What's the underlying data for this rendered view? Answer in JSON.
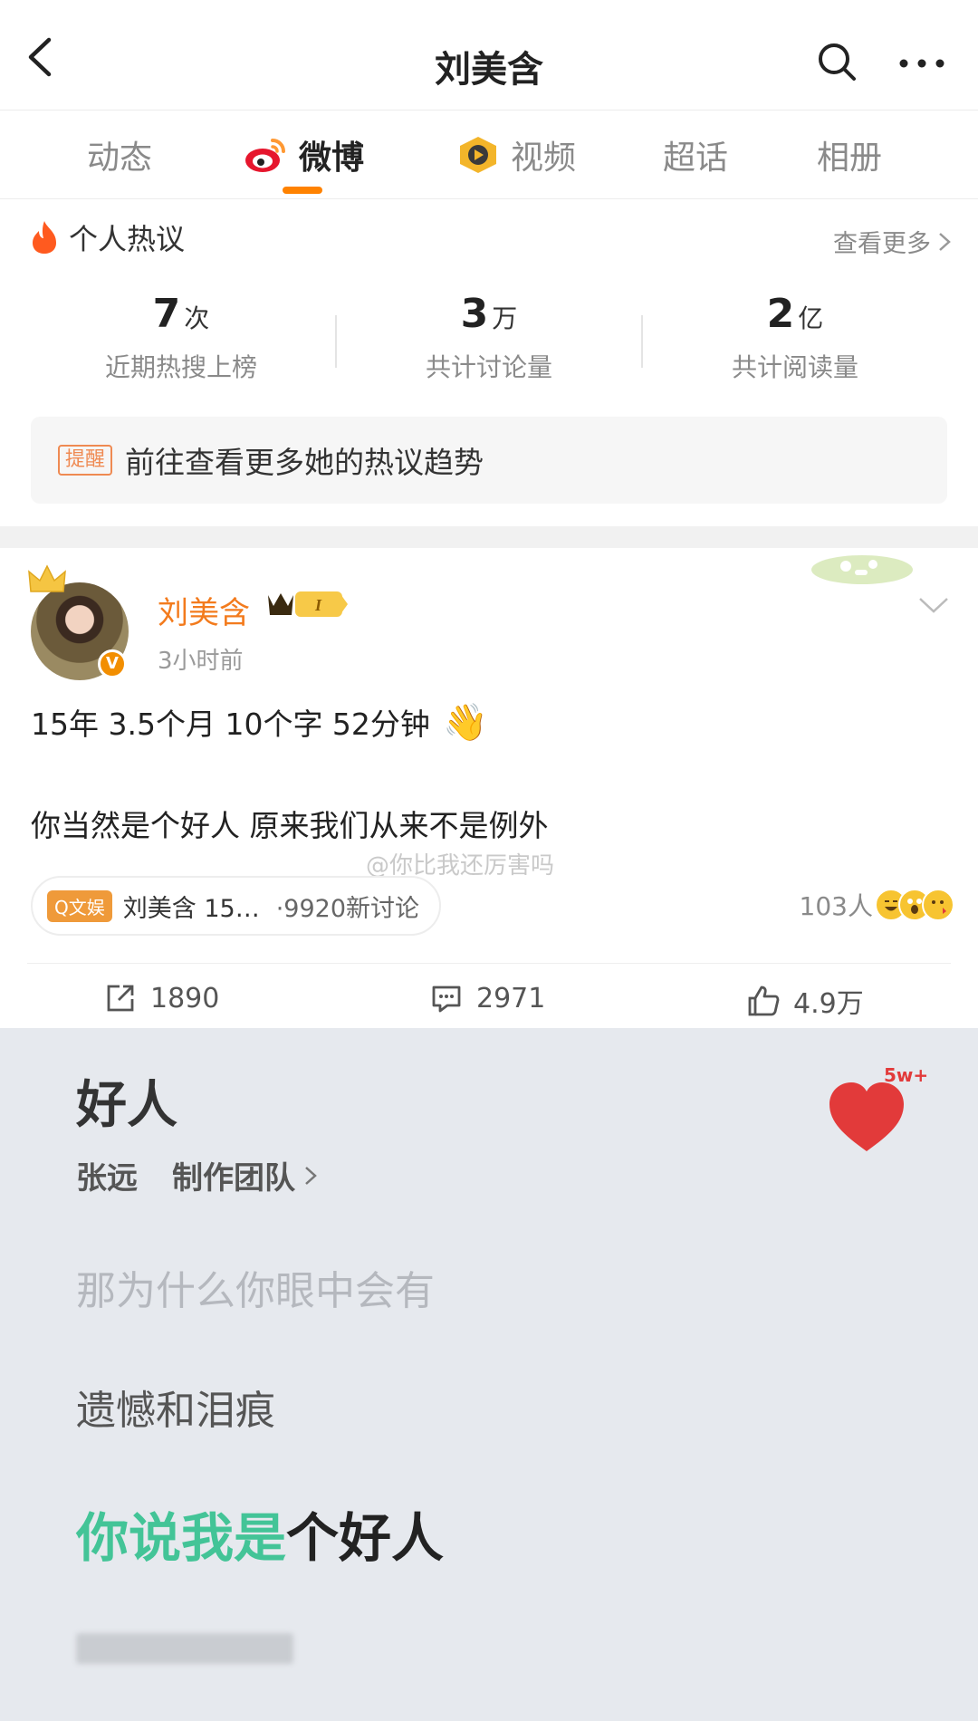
{
  "navbar": {
    "title": "刘美含"
  },
  "tabs": [
    {
      "label": "动态"
    },
    {
      "label": "微博"
    },
    {
      "label": "视频"
    },
    {
      "label": "超话"
    },
    {
      "label": "相册"
    }
  ],
  "hot": {
    "title": "个人热议",
    "see_more": "查看更多",
    "stats": [
      {
        "num": "7",
        "unit": "次",
        "label": "近期热搜上榜"
      },
      {
        "num": "3",
        "unit": "万",
        "label": "共计讨论量"
      },
      {
        "num": "2",
        "unit": "亿",
        "label": "共计阅读量"
      }
    ],
    "reminder_tag": "提醒",
    "reminder_text": "前往查看更多她的热议趋势"
  },
  "post": {
    "user_name": "刘美含",
    "time": "3小时前",
    "line1": "15年 3.5个月 10个字 52分钟",
    "line1_emoji": "👋",
    "line2": "你当然是个好人   原来我们从来不是例外",
    "watermark": "@你比我还厉害吗",
    "topic_tag": "Q文娱",
    "topic_title": "刘美含 15…",
    "topic_discuss": "·9920新讨论",
    "reactors_count": "103人",
    "reposts": "1890",
    "comments": "2971",
    "likes": "4.9万"
  },
  "song": {
    "title": "好人",
    "artist": "张远",
    "team": "制作团队",
    "heart_count": "5w+",
    "lyric1": "那为什么你眼中会有",
    "lyric2": "遗憾和泪痕",
    "lyric3_sung": "你说我是",
    "lyric3_rest": "个好人",
    "colors": {
      "sung": "#43c497",
      "heart": "#e23a3a",
      "accent": "#ff8200",
      "name": "#f37b1d"
    }
  }
}
